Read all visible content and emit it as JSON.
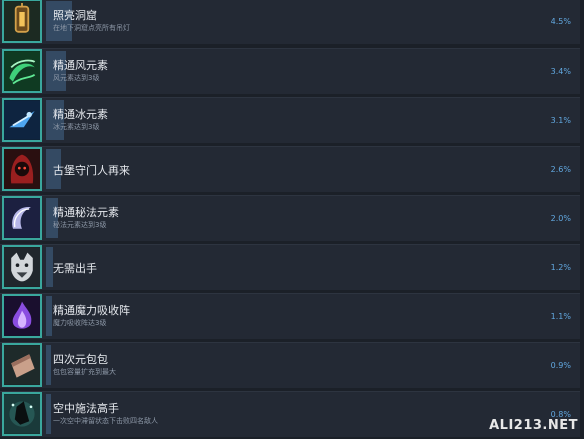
{
  "achievements": [
    {
      "title": "照亮洞窟",
      "desc": "在地下洞窟点亮所有吊灯",
      "percent_text": "4.5%",
      "percent": 4.5,
      "icon": "lantern-icon"
    },
    {
      "title": "精通风元素",
      "desc": "风元素达到3级",
      "percent_text": "3.4%",
      "percent": 3.4,
      "icon": "wind-swirl-icon"
    },
    {
      "title": "精通冰元素",
      "desc": "冰元素达到3级",
      "percent_text": "3.1%",
      "percent": 3.1,
      "icon": "ice-shard-icon"
    },
    {
      "title": "古堡守门人再来",
      "desc": "",
      "percent_text": "2.6%",
      "percent": 2.6,
      "icon": "red-demon-icon"
    },
    {
      "title": "精通秘法元素",
      "desc": "秘法元素达到3级",
      "percent_text": "2.0%",
      "percent": 2.0,
      "icon": "arcane-crescent-icon"
    },
    {
      "title": "无需出手",
      "desc": "",
      "percent_text": "1.2%",
      "percent": 1.2,
      "icon": "wolf-head-icon"
    },
    {
      "title": "精通魔力吸收阵",
      "desc": "魔力吸收阵达3级",
      "percent_text": "1.1%",
      "percent": 1.1,
      "icon": "purple-flame-icon"
    },
    {
      "title": "四次元包包",
      "desc": "包包容量扩充到最大",
      "percent_text": "0.9%",
      "percent": 0.9,
      "icon": "pouch-icon"
    },
    {
      "title": "空中施法高手",
      "desc": "一次空中滞留状态下击败四名敌人",
      "percent_text": "0.8%",
      "percent": 0.8,
      "icon": "witch-silhouette-icon"
    }
  ],
  "watermark": "ALI213.NET",
  "colors": {
    "background": "#1b2028",
    "row": "#232934",
    "bar": "#344a63",
    "percent": "#62a8e0",
    "icon_border": "#3aa79d"
  }
}
